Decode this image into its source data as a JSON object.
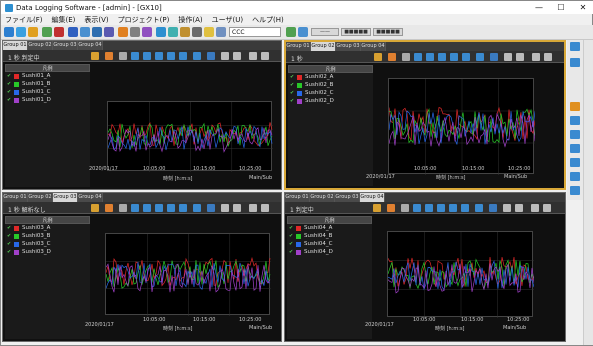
{
  "window": {
    "title": "Data Logging Software - [admin] - [GX10]",
    "min": "—",
    "max": "☐",
    "close": "✕"
  },
  "menu": [
    "ファイル(F)",
    "編集(E)",
    "表示(V)",
    "プロジェクト(P)",
    "操作(A)",
    "ユーザ(U)",
    "ヘルプ(H)"
  ],
  "toolbar": {
    "search_value": "CCC",
    "btn1": "——",
    "btn2": "■■■■■",
    "btn3": "■■■■■"
  },
  "panes": [
    {
      "tabs": [
        "Group 01",
        "Group 02",
        "Group 03",
        "Group 04"
      ],
      "active": 0,
      "label": "1 秒 判定中",
      "legend_header": "凡例",
      "items": [
        {
          "name": "Sushi01_A",
          "color": "#e02828"
        },
        {
          "name": "Sushi01_B",
          "color": "#28c828"
        },
        {
          "name": "Sushi01_C",
          "color": "#2868e8"
        },
        {
          "name": "Sushi01_D",
          "color": "#a040c8"
        }
      ],
      "date": "2020/01/17",
      "time": "10:05:00",
      "time2": "10:15:00",
      "time3": "10:25:00",
      "xlabel": "時刻 [h:m:s]",
      "mode": "Main/Sub"
    },
    {
      "tabs": [
        "Group 01",
        "Group 02",
        "Group 03",
        "Group 04"
      ],
      "active": 1,
      "label": "1 秒",
      "legend_header": "凡例",
      "items": [
        {
          "name": "Sushi02_A",
          "color": "#e02828"
        },
        {
          "name": "Sushi02_B",
          "color": "#28c828"
        },
        {
          "name": "Sushi02_C",
          "color": "#2868e8"
        },
        {
          "name": "Sushi02_D",
          "color": "#a040c8"
        }
      ],
      "date": "2020/01/17",
      "time": "10:05:00",
      "time2": "10:15:00",
      "time3": "10:25:00",
      "xlabel": "時刻 [h:m:s]",
      "mode": "Main/Sub"
    },
    {
      "tabs": [
        "Group 01",
        "Group 02",
        "Group 03",
        "Group 04"
      ],
      "active": 2,
      "label": "1 秒 解析なし",
      "legend_header": "凡例",
      "items": [
        {
          "name": "Sushi03_A",
          "color": "#e02828"
        },
        {
          "name": "Sushi03_B",
          "color": "#28c828"
        },
        {
          "name": "Sushi03_C",
          "color": "#2868e8"
        },
        {
          "name": "Sushi03_D",
          "color": "#a040c8"
        }
      ],
      "date": "2020/01/17",
      "time": "10:05:00",
      "time2": "10:15:00",
      "time3": "10:25:00",
      "xlabel": "時刻 [h:m:s]",
      "mode": "Main/Sub"
    },
    {
      "tabs": [
        "Group 01",
        "Group 02",
        "Group 03",
        "Group 04"
      ],
      "active": 3,
      "label": "1 判定中",
      "legend_header": "凡例",
      "items": [
        {
          "name": "Sushi04_A",
          "color": "#e02828"
        },
        {
          "name": "Sushi04_B",
          "color": "#28c828"
        },
        {
          "name": "Sushi04_C",
          "color": "#2868e8"
        },
        {
          "name": "Sushi04_D",
          "color": "#a040c8"
        }
      ],
      "date": "2020/01/17",
      "time": "10:05:00",
      "time2": "10:15:00",
      "time3": "10:25:00",
      "xlabel": "時刻 [h:m:s]",
      "mode": "Main/Sub"
    }
  ]
}
